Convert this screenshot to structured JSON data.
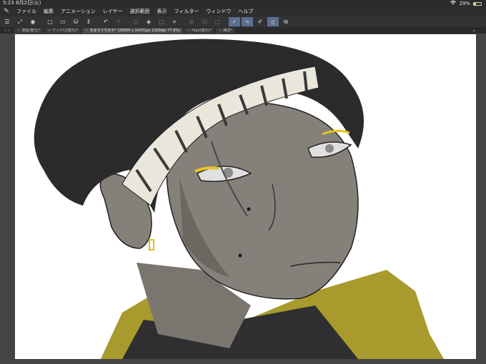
{
  "status_bar": {
    "time": "5:23",
    "date": "8月2日(火)",
    "battery_percent": "29%",
    "battery_level": 0.29,
    "icons": [
      "wifi-icon",
      "battery-icon"
    ]
  },
  "menu": {
    "items": [
      "ファイル",
      "編集",
      "アニメーション",
      "レイヤー",
      "選択範囲",
      "表示",
      "フィルター",
      "ウィンドウ",
      "ヘルプ"
    ]
  },
  "toolbar": {
    "buttons": [
      "hamburger-menu-icon",
      "transform-icon",
      "eye-icon",
      "new-file-icon",
      "open-folder-icon",
      "save-icon",
      "stepper-icon",
      "undo-icon",
      "redo-icon",
      "select-icon",
      "fill-icon",
      "snap-icon",
      "crop-icon",
      "ruler-icon",
      "brush-icon",
      "square-icon",
      "pen-icon",
      "curve-icon",
      "draw-icon",
      "phone-icon",
      "copy-icon"
    ]
  },
  "tabs": {
    "items": [
      {
        "label": "漫画(復元)*",
        "active": false
      },
      {
        "label": "ワンド口(復元)*",
        "active": false
      },
      {
        "label": "まほろうちの子* (20000 x 14031px 1200dpi 77.9%)",
        "active": true
      },
      {
        "label": "High(復元)*",
        "active": false
      },
      {
        "label": "練習*",
        "active": false
      }
    ]
  },
  "colors": {
    "skin": "#86807b",
    "skin_shadow": "#6d6762",
    "hair": "#2b2b2b",
    "jacket_yellow": "#a89a2c",
    "jacket_dark": "#2f2f31",
    "band_light": "#e9e6dc",
    "band_dark": "#3a3a3a",
    "eye_liner": "#e5c521",
    "accent": "#5d6f8f"
  }
}
